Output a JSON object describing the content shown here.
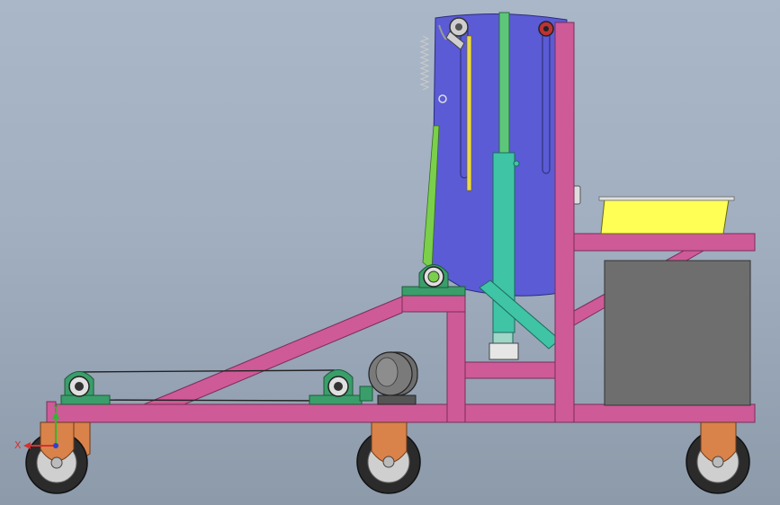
{
  "viewport": {
    "background_top": "#a9b7c8",
    "background_bottom": "#8c9aaa"
  },
  "colors": {
    "frame": "#cf5a98",
    "frame_edge": "#7a2e59",
    "drum": "#5b5bd6",
    "drum_edge": "#2c2c7a",
    "cylinder": "#3fc4a6",
    "cylinder_edge": "#1e6a5a",
    "bearing": "#3a9e6a",
    "tray": "#ffff55",
    "cabinet": "#6e6e6e",
    "wheel_tire": "#2b2b2b",
    "wheel_fork": "#d9824a",
    "motor": "#6d6d6d",
    "rod": "#e8d84a",
    "spring": "#bdbdbd"
  },
  "triad": {
    "x_label": "X",
    "y_label": "Y",
    "x_color": "#d63030",
    "y_color": "#2fb82f",
    "z_color": "#3040d0"
  }
}
